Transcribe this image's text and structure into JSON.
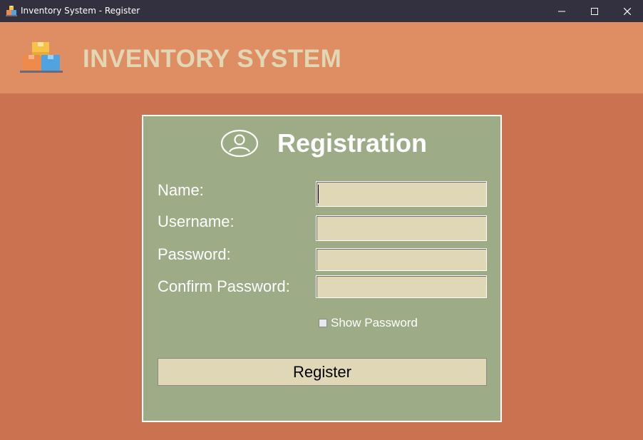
{
  "window": {
    "title": "Inventory System - Register",
    "controls": [
      "minimize",
      "maximize",
      "close"
    ]
  },
  "header": {
    "brand": "INVENTORY SYSTEM",
    "logo_icon": "boxes-icon"
  },
  "form": {
    "title": "Registration",
    "title_icon": "user-circle-icon",
    "fields": {
      "name": {
        "label": "Name:",
        "value": ""
      },
      "username": {
        "label": "Username:",
        "value": ""
      },
      "password": {
        "label": "Password:",
        "value": ""
      },
      "confirm_password": {
        "label": "Confirm Password:",
        "value": ""
      }
    },
    "show_password": {
      "label": "Show Password",
      "checked": false
    },
    "register_label": "Register"
  },
  "colors": {
    "titlebar": "#333040",
    "header_bg": "#df8d62",
    "brand_text": "#e1d7b4",
    "page_bg": "#cb7350",
    "panel_bg": "#9dab87",
    "field_bg": "#dfd7b5"
  }
}
